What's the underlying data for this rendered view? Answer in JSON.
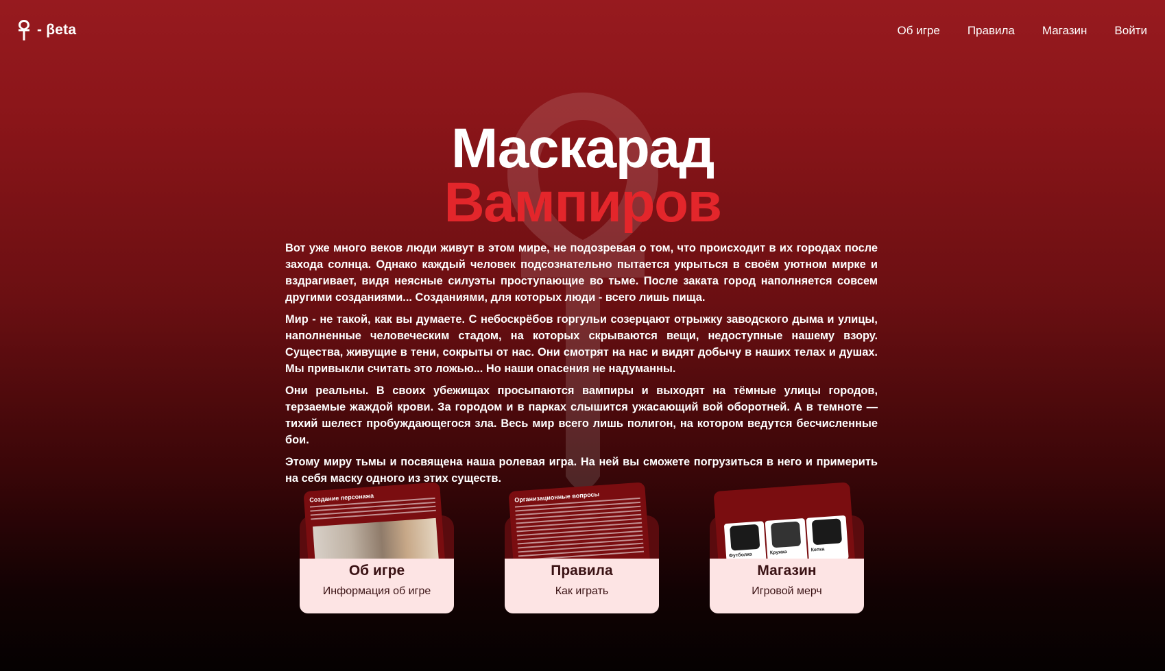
{
  "brand": {
    "text": "- βeta"
  },
  "nav": {
    "items": [
      "Об игре",
      "Правила",
      "Магазин",
      "Войти"
    ]
  },
  "hero": {
    "title_line1": "Маскарад",
    "title_line2": "Вампиров",
    "title_line2_color": "#e3262b",
    "paragraphs": [
      "Вот уже много веков люди живут в этом мире, не подозревая о том, что происходит в их городах после захода солнца. Однако каждый человек подсознательно пытается укрыться в своём уютном мирке и вздрагивает, видя неясные силуэты проступающие во тьме. После заката город наполняется совсем другими созданиями... Созданиями, для которых люди - всего лишь пища.",
      "Мир - не такой, как вы думаете. С небоскрёбов горгульи созерцают отрыжку заводского дыма и улицы, наполненные человеческим стадом, на которых скрываются вещи, недоступные нашему взору. Существа, живущие в тени, сокрыты от нас. Они смотрят на нас и видят добычу в наших телах и душах. Мы привыкли считать это ложью... Но наши опасения не надуманны.",
      "Они реальны. В своих убежищах просыпаются вампиры и выходят на тёмные улицы городов, терзаемые жаждой крови. За городом и в парках слышится ужасающий вой оборотней. А в темноте — тихий шелест пробуждающегося зла. Весь мир всего лишь полигон, на котором ведутся бесчисленные бои.",
      "Этому миру тьмы и посвящена наша ролевая игра. На ней вы сможете погрузиться в него и примерить на себя маску одного из этих существ."
    ]
  },
  "cards": [
    {
      "title": "Об игре",
      "subtitle": "Информация об игре",
      "preview_heading": "Создание персонажа",
      "preview_kind": "photo"
    },
    {
      "title": "Правила",
      "subtitle": "Как играть",
      "preview_heading": "Организационные вопросы",
      "preview_kind": "text"
    },
    {
      "title": "Магазин",
      "subtitle": "Игровой мерч",
      "preview_kind": "merch",
      "merch": [
        {
          "label": "Футболка"
        },
        {
          "label": "Кружка"
        },
        {
          "label": "Кепка"
        }
      ]
    }
  ],
  "icons": {
    "logo": "ankh-icon",
    "watermark": "ankh-icon"
  }
}
